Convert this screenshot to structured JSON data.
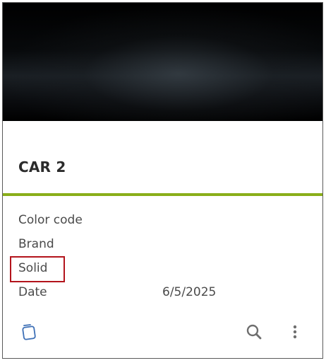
{
  "card": {
    "title": "CAR 2",
    "properties": [
      {
        "label": "Color code",
        "value": ""
      },
      {
        "label": "Brand",
        "value": ""
      },
      {
        "label": "Solid",
        "value": ""
      },
      {
        "label": "Date",
        "value": "6/5/2025"
      }
    ],
    "highlighted_label": "Solid"
  },
  "footer": {
    "icons": [
      "cards-icon",
      "search-icon",
      "more-vertical-icon"
    ]
  },
  "colors": {
    "accent": "#8aae1a",
    "highlight": "#b3141c",
    "icon_blue": "#3d6fb6",
    "icon_gray": "#6e6e6e"
  }
}
